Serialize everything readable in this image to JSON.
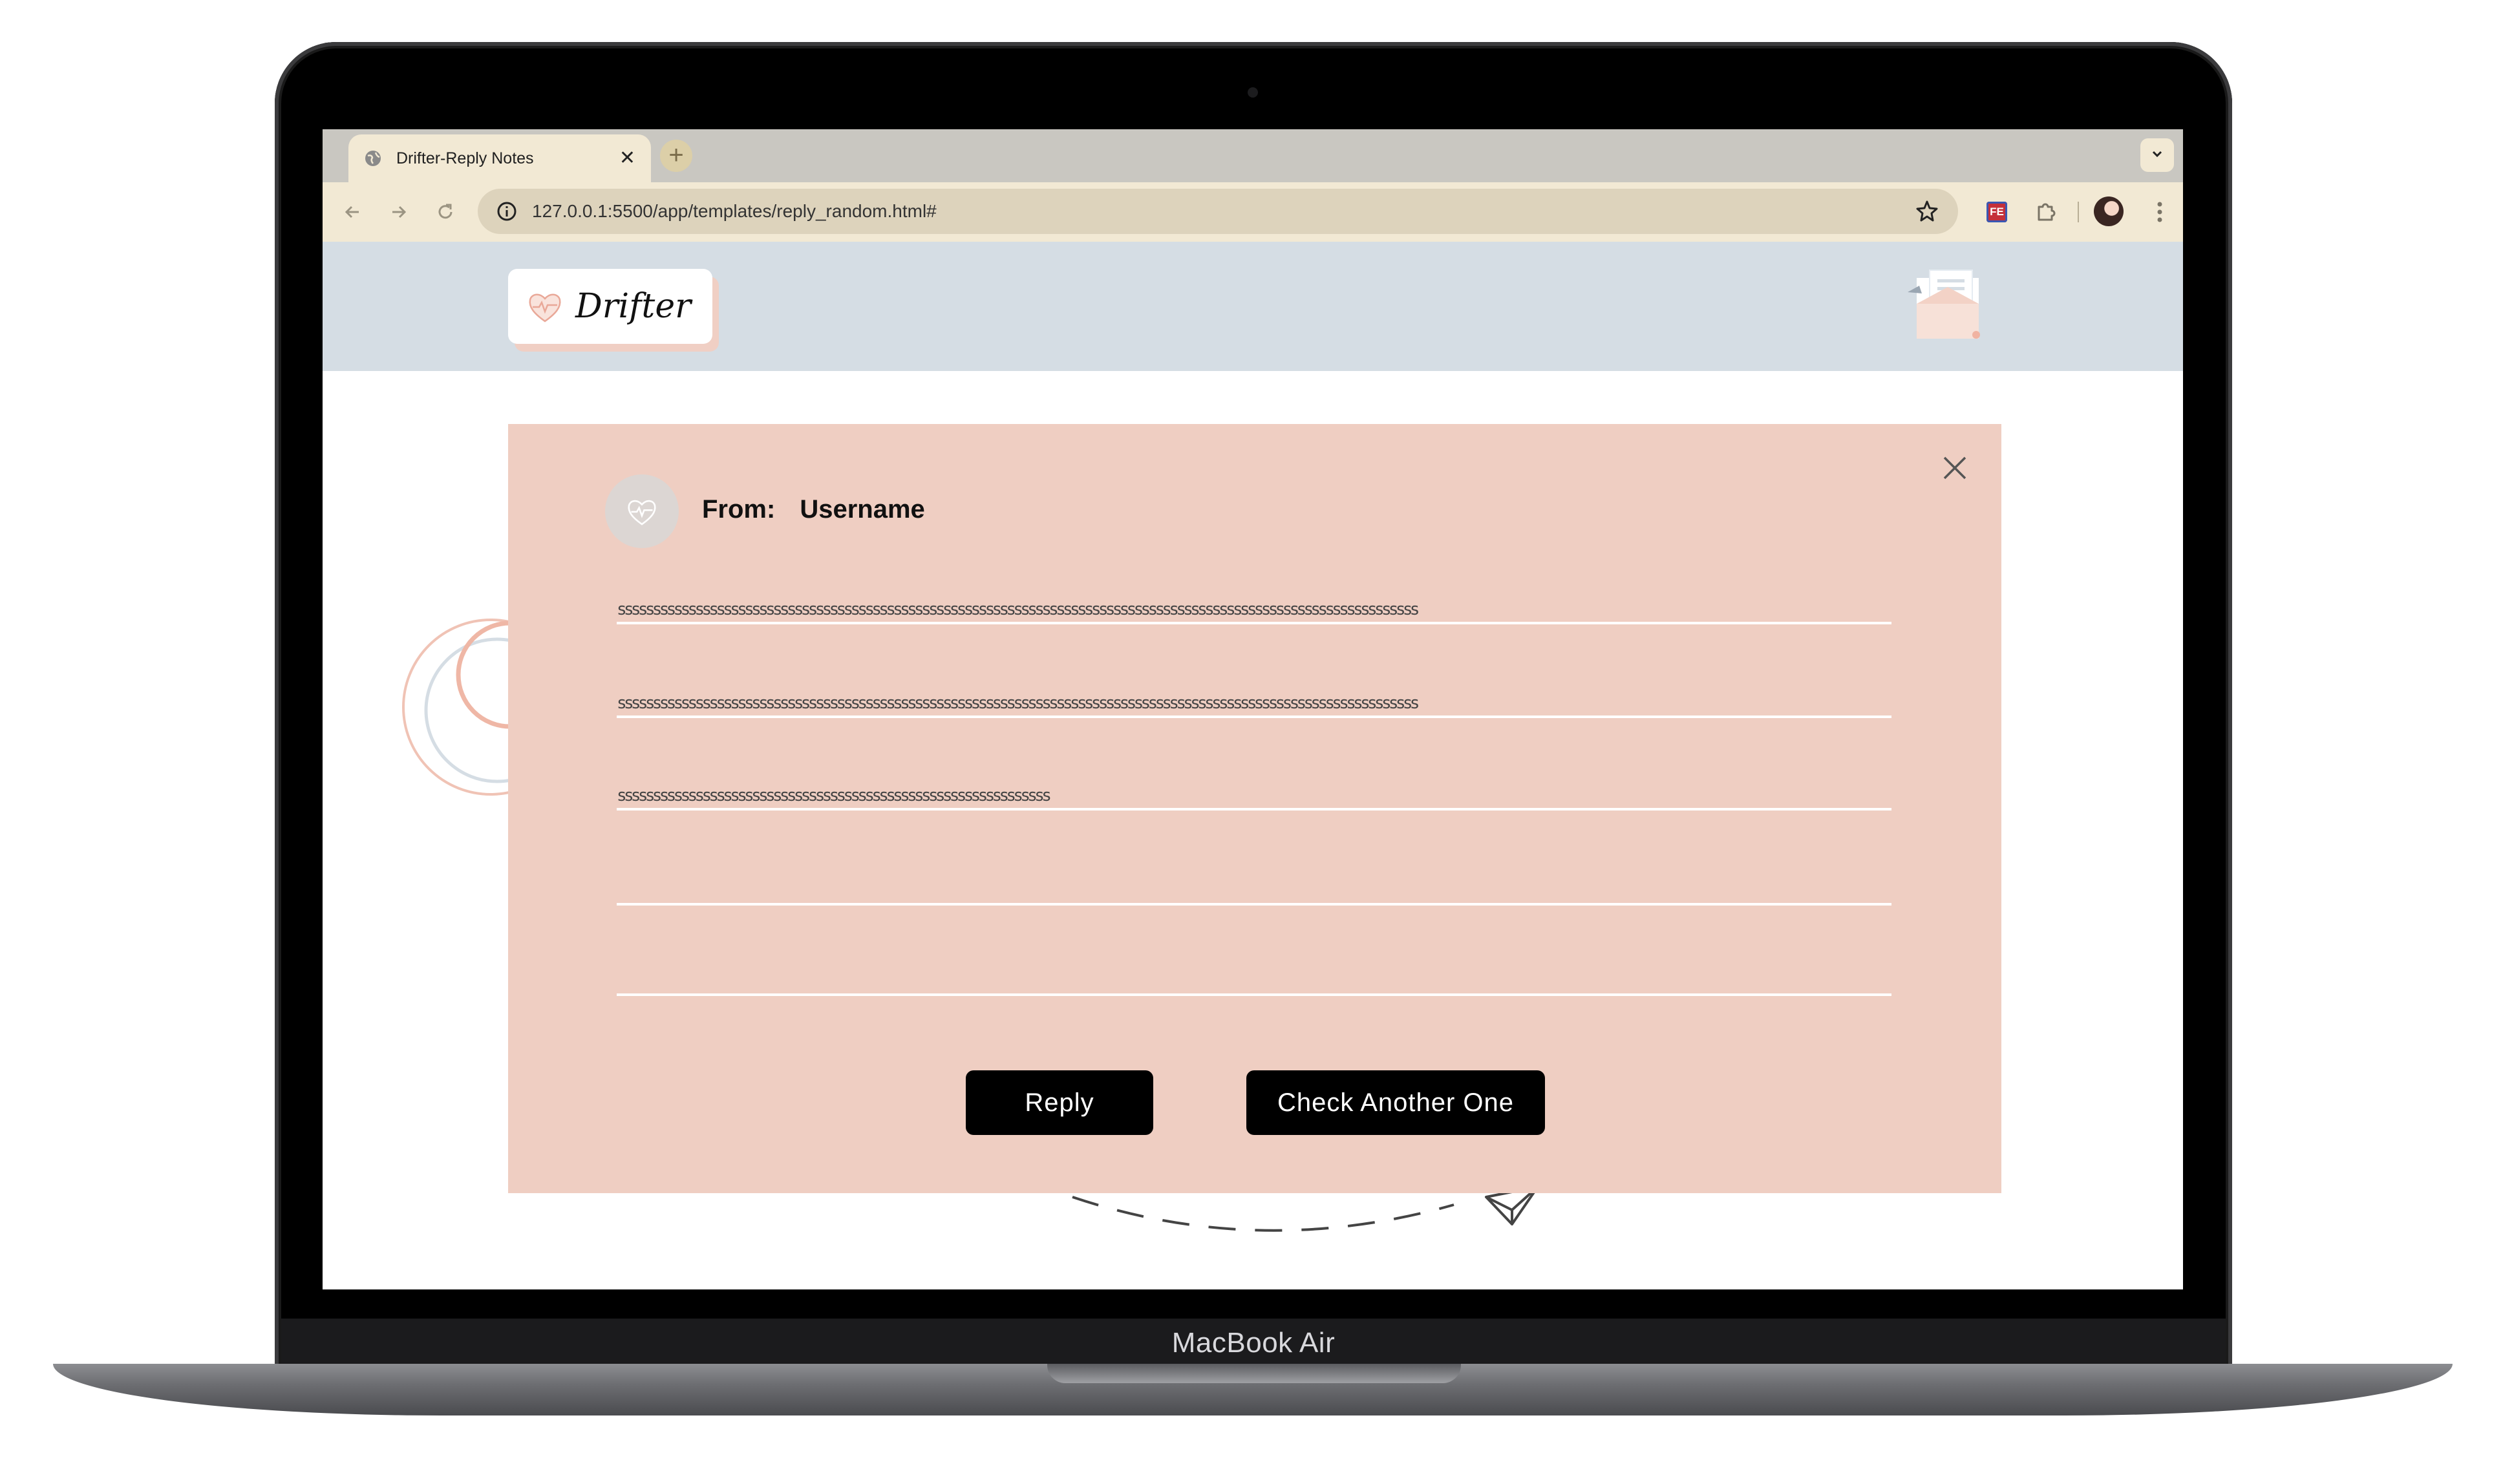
{
  "device": {
    "label": "MacBook Air"
  },
  "browser": {
    "tab": {
      "title": "Drifter-Reply Notes",
      "close": "✕"
    },
    "new_tab": "+",
    "address": {
      "url": "127.0.0.1:5500/app/templates/reply_random.html#"
    },
    "extension_badge": "FE"
  },
  "site": {
    "logo_text": "Drifter"
  },
  "note": {
    "from_label": "From:",
    "from_username": "Username",
    "lines": [
      "sssssssssssssssssssssssssssssssssssssssssssssssssssssssssssssssssssssssssssssssssssssssssssssssssssssssssssssssss",
      "sssssssssssssssssssssssssssssssssssssssssssssssssssssssssssssssssssssssssssssssssssssssssssssssssssssssssssssssss",
      "sssssssssssssssssssssssssssssssssssssssssssssssssssssssssssss",
      "",
      ""
    ],
    "reply_button": "Reply",
    "another_button": "Check Another One"
  },
  "colors": {
    "note_background": "#efcec2",
    "header_background": "#d5dde4",
    "browser_chrome": "#f2e9d4",
    "button": "#000000"
  },
  "icons": [
    "globe-icon",
    "close-icon",
    "plus-icon",
    "chevron-down-icon",
    "back-arrow-icon",
    "forward-arrow-icon",
    "reload-icon",
    "info-icon",
    "star-icon",
    "puzzle-icon",
    "more-vert-icon",
    "heart-icon",
    "letter-icon",
    "paper-plane-icon"
  ]
}
